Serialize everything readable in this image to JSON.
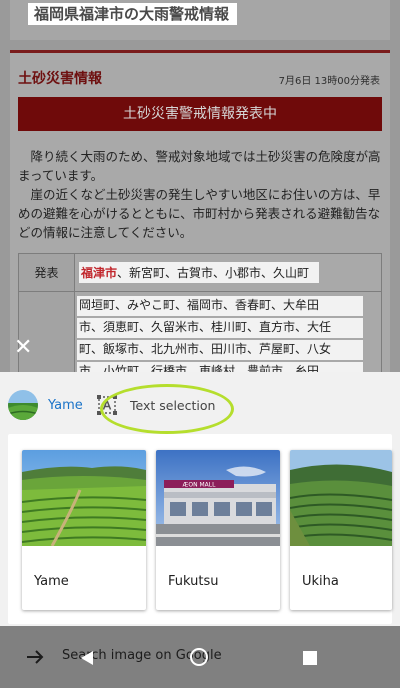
{
  "webpage": {
    "title": "福岡県福津市の大雨警戒情報",
    "section_title": "土砂災害情報",
    "date": "7月6日 13時00分発表",
    "alert": "土砂災害警戒情報発表中",
    "paragraph1": "降り続く大雨のため、警戒対象地域では土砂災害の危険度が高まっています。",
    "paragraph2": "崖の近くなど土砂災害の発生しやすい地区にお住いの方は、早めの避難を心がけるとともに、市町村から発表される避難勧告などの情報に注意してください。",
    "table": {
      "row_header": "発表",
      "highlight": "福津市",
      "rest": "、新宮町、古賀市、小郡市、久山町",
      "municipalities": [
        "岡垣町、みやこ町、福岡市、香春町、大牟田",
        "市、須恵町、久留米市、桂川町、直方市、大任",
        "町、飯塚市、北九州市、田川市、芦屋町、八女",
        "市、小竹町、行橋市、東峰村、豊前市、糸田"
      ]
    }
  },
  "overlay": {
    "close_icon": "close-icon"
  },
  "sheet": {
    "tabs": {
      "yame": {
        "label": "Yame"
      },
      "text_selection": {
        "label": "Text selection",
        "icon": "text-selection-icon"
      }
    },
    "cards": [
      {
        "label": "Yame",
        "image": "green-tea-field-image"
      },
      {
        "label": "Fukutsu",
        "image": "aeon-mall-image"
      },
      {
        "label": "Ukiha",
        "image": "terraced-rice-fields-image"
      }
    ],
    "aeon_sign": "ÆON MALL",
    "search_label": "Search image on Google"
  },
  "colors": {
    "accent_green": "#b5de2d",
    "link_blue": "#1a73c8",
    "alert_red": "#c1272d"
  }
}
